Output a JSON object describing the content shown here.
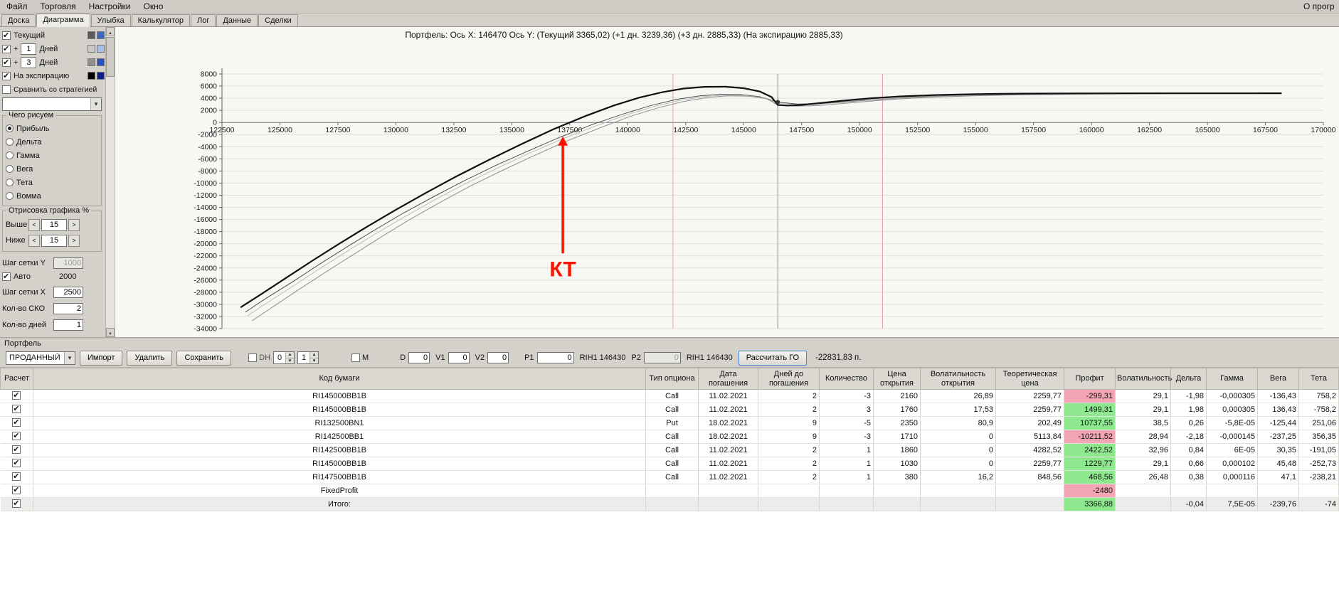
{
  "menubar": {
    "items": [
      "Файл",
      "Торговля",
      "Настройки",
      "Окно"
    ],
    "right": "О прогр"
  },
  "tabs": [
    "Доска",
    "Диаграмма",
    "Улыбка",
    "Калькулятор",
    "Лог",
    "Данные",
    "Сделки"
  ],
  "active_tab": "Диаграмма",
  "sidebar": {
    "lines": [
      {
        "label": "Текущий",
        "checked": true,
        "swatches": [
          "#5a5a5a",
          "#3a66c8"
        ]
      },
      {
        "prefix": "+",
        "value": "1",
        "label": "Дней",
        "checked": true,
        "swatches": [
          "#c9c9c9",
          "#a3c1ec"
        ]
      },
      {
        "prefix": "+",
        "value": "3",
        "label": "Дней",
        "checked": true,
        "swatches": [
          "#909090",
          "#2b50c8"
        ]
      },
      {
        "label": "На экспирацию",
        "checked": true,
        "swatches": [
          "#000000",
          "#0b1f93"
        ]
      },
      {
        "label": "Сравнить со стратегией",
        "checked": false
      }
    ],
    "draw_group": {
      "title": "Чего рисуем",
      "options": [
        "Прибыль",
        "Дельта",
        "Гамма",
        "Вега",
        "Тета",
        "Вомма"
      ],
      "selected": "Прибыль"
    },
    "render_group": {
      "title": "Отрисовка графика %",
      "above_label": "Выше",
      "above_value": "15",
      "below_label": "Ниже",
      "below_value": "15"
    },
    "grid_y_label": "Шаг сетки Y",
    "grid_y_value": "1000",
    "auto_label": "Авто",
    "auto_value": "2000",
    "grid_x_label": "Шаг сетки X",
    "grid_x_value": "2500",
    "sko_label": "Кол-во СКО",
    "sko_value": "2",
    "days_label": "Кол-во дней",
    "days_value": "1"
  },
  "chart_data": {
    "type": "line",
    "title": "Портфель: Ось X: 146470 Ось Y:  (Текущий 3365,02)  (+1 дн. 3239,36)  (+3 дн. 2885,33)  (На экспирацию 2885,33)",
    "x_min": 122500,
    "x_max": 170000,
    "x_step": 2500,
    "y_min": -34000,
    "y_max": 8000,
    "y_step": 2000,
    "grid": true,
    "current_x": 146470,
    "current_line_color": "#8f8f8f",
    "sko_lines": [
      141950,
      150990
    ],
    "sko_color": "#e9a3b4",
    "marker": {
      "x": 146470,
      "y": 3365
    },
    "annotation": {
      "label": "КТ",
      "x": 137200,
      "y_tip": -2300,
      "y_base": -21600,
      "color": "#f81400"
    },
    "series": [
      {
        "name": "Текущий",
        "color": "#4f4f4f",
        "width": 1,
        "points": [
          [
            123500,
            -31300
          ],
          [
            124400,
            -29000
          ],
          [
            125500,
            -26400
          ],
          [
            126700,
            -23400
          ],
          [
            127900,
            -20500
          ],
          [
            129100,
            -17700
          ],
          [
            130300,
            -15000
          ],
          [
            131600,
            -12300
          ],
          [
            132900,
            -9700
          ],
          [
            134300,
            -7100
          ],
          [
            135700,
            -4700
          ],
          [
            137100,
            -2400
          ],
          [
            138500,
            -300
          ],
          [
            139800,
            1400
          ],
          [
            141000,
            2800
          ],
          [
            142100,
            3800
          ],
          [
            143100,
            4400
          ],
          [
            144000,
            4650
          ],
          [
            144900,
            4600
          ],
          [
            145700,
            4250
          ],
          [
            146470,
            3365
          ],
          [
            147300,
            3050
          ],
          [
            148200,
            3100
          ],
          [
            149200,
            3350
          ],
          [
            150400,
            3700
          ],
          [
            151800,
            4050
          ],
          [
            153300,
            4300
          ],
          [
            155000,
            4490
          ],
          [
            157000,
            4620
          ],
          [
            159500,
            4710
          ],
          [
            162000,
            4760
          ],
          [
            164500,
            4790
          ],
          [
            166800,
            4800
          ],
          [
            168200,
            4805
          ]
        ]
      },
      {
        "name": "+1 день",
        "color": "#bdbdbd",
        "width": 1,
        "points": [
          [
            123600,
            -31900
          ],
          [
            124500,
            -29600
          ],
          [
            125600,
            -26900
          ],
          [
            126800,
            -23900
          ],
          [
            128000,
            -21000
          ],
          [
            129200,
            -18200
          ],
          [
            130400,
            -15500
          ],
          [
            131700,
            -12700
          ],
          [
            133000,
            -10100
          ],
          [
            134400,
            -7500
          ],
          [
            135800,
            -5000
          ],
          [
            137200,
            -2700
          ],
          [
            138600,
            -600
          ],
          [
            139900,
            1200
          ],
          [
            141100,
            2600
          ],
          [
            142200,
            3600
          ],
          [
            143200,
            4250
          ],
          [
            144100,
            4520
          ],
          [
            145000,
            4480
          ],
          [
            145800,
            4100
          ],
          [
            146470,
            3239
          ],
          [
            147300,
            2950
          ],
          [
            148200,
            3000
          ],
          [
            149200,
            3280
          ],
          [
            150400,
            3640
          ],
          [
            151800,
            4000
          ],
          [
            153300,
            4260
          ],
          [
            155000,
            4460
          ],
          [
            157000,
            4600
          ],
          [
            159500,
            4700
          ],
          [
            162000,
            4750
          ],
          [
            164500,
            4780
          ],
          [
            166800,
            4795
          ],
          [
            168200,
            4800
          ]
        ]
      },
      {
        "name": "+3 дня",
        "color": "#8f8f8f",
        "width": 1,
        "points": [
          [
            123800,
            -32700
          ],
          [
            124700,
            -30400
          ],
          [
            125800,
            -27600
          ],
          [
            127000,
            -24600
          ],
          [
            128200,
            -21700
          ],
          [
            129400,
            -18800
          ],
          [
            130600,
            -16000
          ],
          [
            131900,
            -13200
          ],
          [
            133200,
            -10500
          ],
          [
            134600,
            -7900
          ],
          [
            136000,
            -5400
          ],
          [
            137400,
            -3000
          ],
          [
            138800,
            -900
          ],
          [
            140100,
            1000
          ],
          [
            141300,
            2400
          ],
          [
            142400,
            3450
          ],
          [
            143400,
            4100
          ],
          [
            144300,
            4400
          ],
          [
            145200,
            4350
          ],
          [
            146000,
            3900
          ],
          [
            146470,
            2885
          ],
          [
            147300,
            2700
          ],
          [
            148200,
            2780
          ],
          [
            149200,
            3100
          ],
          [
            150400,
            3500
          ],
          [
            151800,
            3900
          ],
          [
            153300,
            4190
          ],
          [
            155000,
            4410
          ],
          [
            157000,
            4560
          ],
          [
            159500,
            4670
          ],
          [
            162000,
            4730
          ],
          [
            164500,
            4770
          ],
          [
            166800,
            4790
          ],
          [
            168200,
            4800
          ]
        ]
      },
      {
        "name": "На экспирацию",
        "color": "#101010",
        "width": 2.2,
        "points": [
          [
            123300,
            -30500
          ],
          [
            124200,
            -28300
          ],
          [
            125200,
            -25800
          ],
          [
            126400,
            -22800
          ],
          [
            127600,
            -19900
          ],
          [
            128800,
            -17100
          ],
          [
            130000,
            -14400
          ],
          [
            131300,
            -11600
          ],
          [
            132600,
            -8900
          ],
          [
            134000,
            -6200
          ],
          [
            135400,
            -3600
          ],
          [
            136800,
            -1100
          ],
          [
            138200,
            1100
          ],
          [
            139400,
            2800
          ],
          [
            140500,
            4100
          ],
          [
            141500,
            5000
          ],
          [
            142400,
            5600
          ],
          [
            143300,
            5880
          ],
          [
            144200,
            5900
          ],
          [
            145000,
            5650
          ],
          [
            145700,
            5100
          ],
          [
            146200,
            4200
          ],
          [
            146470,
            2890
          ],
          [
            146900,
            2790
          ],
          [
            147500,
            2900
          ],
          [
            148300,
            3200
          ],
          [
            149300,
            3600
          ],
          [
            150500,
            4000
          ],
          [
            151800,
            4300
          ],
          [
            153300,
            4530
          ],
          [
            155000,
            4680
          ],
          [
            157000,
            4760
          ],
          [
            159500,
            4800
          ],
          [
            162000,
            4810
          ],
          [
            164500,
            4810
          ],
          [
            166800,
            4810
          ],
          [
            168200,
            4815
          ]
        ]
      }
    ]
  },
  "portfolio_bar": {
    "section_label": "Портфель",
    "selector_value": "ПРОДАННЫЙ",
    "buttons": [
      "Импорт",
      "Удалить",
      "Сохранить"
    ],
    "dh_label": "DH",
    "spin1": "0",
    "spin2": "1",
    "m_label": "M",
    "d_label": "D",
    "d_value": "0",
    "v1_label": "V1",
    "v1_value": "0",
    "v2_label": "V2",
    "v2_value": "0",
    "p1_label": "P1",
    "p1_value": "0",
    "rih1_a": "RIH1 146430",
    "p2_label": "P2",
    "p2_value": "0",
    "rih1_b": "RIH1 146430",
    "calc_button": "Рассчитать ГО",
    "result": "-22831,83 п."
  },
  "table": {
    "headers": [
      "Расчет",
      "Код бумаги",
      "Тип опциона",
      "Дата погашения",
      "Дней до погашения",
      "Количество",
      "Цена открытия",
      "Волатильность открытия",
      "Теоретическая цена",
      "Профит",
      "Волатильность",
      "Дельта",
      "Гамма",
      "Вега",
      "Тета"
    ],
    "rows": [
      {
        "checked": true,
        "profit": "neg",
        "cells": [
          "RI145000BB1B",
          "Call",
          "11.02.2021",
          "2",
          "-3",
          "2160",
          "26,89",
          "2259,77",
          "-299,31",
          "29,1",
          "-1,98",
          "-0,000305",
          "-136,43",
          "758,2"
        ]
      },
      {
        "checked": true,
        "profit": "pos",
        "cells": [
          "RI145000BB1B",
          "Call",
          "11.02.2021",
          "2",
          "3",
          "1760",
          "17,53",
          "2259,77",
          "1499,31",
          "29,1",
          "1,98",
          "0,000305",
          "136,43",
          "-758,2"
        ]
      },
      {
        "checked": true,
        "profit": "pos",
        "cells": [
          "RI132500BN1",
          "Put",
          "18.02.2021",
          "9",
          "-5",
          "2350",
          "80,9",
          "202,49",
          "10737,55",
          "38,5",
          "0,26",
          "-5,8E-05",
          "-125,44",
          "251,06"
        ]
      },
      {
        "checked": true,
        "profit": "neg",
        "cells": [
          "RI142500BB1",
          "Call",
          "18.02.2021",
          "9",
          "-3",
          "1710",
          "0",
          "5113,84",
          "-10211,52",
          "28,94",
          "-2,18",
          "-0,000145",
          "-237,25",
          "356,35"
        ]
      },
      {
        "checked": true,
        "profit": "pos",
        "cells": [
          "RI142500BB1B",
          "Call",
          "11.02.2021",
          "2",
          "1",
          "1860",
          "0",
          "4282,52",
          "2422,52",
          "32,96",
          "0,84",
          "6E-05",
          "30,35",
          "-191,05"
        ]
      },
      {
        "checked": true,
        "profit": "pos",
        "cells": [
          "RI145000BB1B",
          "Call",
          "11.02.2021",
          "2",
          "1",
          "1030",
          "0",
          "2259,77",
          "1229,77",
          "29,1",
          "0,66",
          "0,000102",
          "45,48",
          "-252,73"
        ]
      },
      {
        "checked": true,
        "profit": "pos",
        "cells": [
          "RI147500BB1B",
          "Call",
          "11.02.2021",
          "2",
          "1",
          "380",
          "16,2",
          "848,56",
          "468,56",
          "26,48",
          "0,38",
          "0,000116",
          "47,1",
          "-238,21"
        ]
      },
      {
        "checked": true,
        "profit": "neg",
        "cells": [
          "FixedProfit",
          "",
          "",
          "",
          "",
          "",
          "",
          "",
          "-2480",
          "",
          "",
          "",
          "",
          ""
        ]
      },
      {
        "checked": true,
        "profit": "pos",
        "total": true,
        "cells": [
          "Итого:",
          "",
          "",
          "",
          "",
          "",
          "",
          "",
          "3366,88",
          "",
          "-0,04",
          "7,5E-05",
          "-239,76",
          "-74"
        ]
      }
    ]
  }
}
